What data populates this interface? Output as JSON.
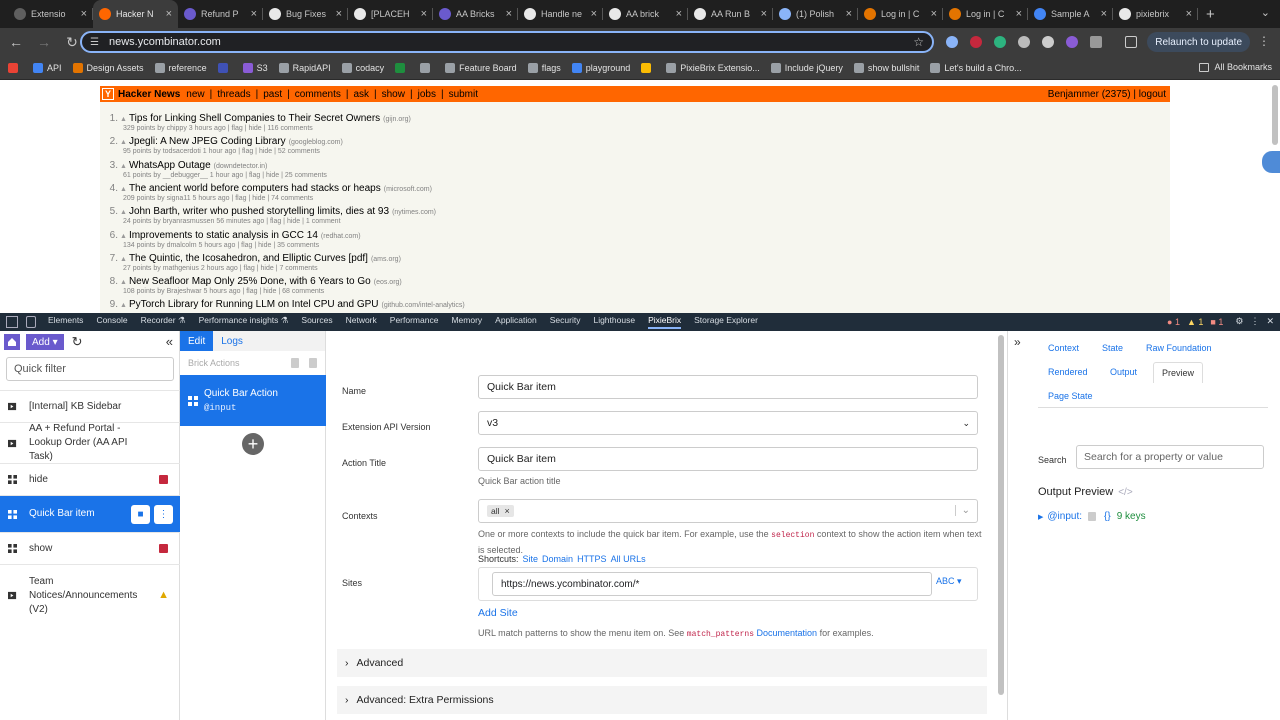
{
  "browser": {
    "tabs": [
      {
        "label": "Extensio",
        "color": "#5f5f5f"
      },
      {
        "label": "Hacker N",
        "color": "#ff6600",
        "active": true
      },
      {
        "label": "Refund P",
        "color": "#6a5acd"
      },
      {
        "label": "Bug Fixes",
        "color": "#e8e8e8"
      },
      {
        "label": "[PLACEH",
        "color": "#e8e8e8"
      },
      {
        "label": "AA Bricks",
        "color": "#6a5acd"
      },
      {
        "label": "Handle ne",
        "color": "#e8e8e8"
      },
      {
        "label": "AA brick",
        "color": "#e8e8e8"
      },
      {
        "label": "AA Run B",
        "color": "#e8e8e8"
      },
      {
        "label": "(1) Polish",
        "color": "#8ab4f8"
      },
      {
        "label": "Log in | C",
        "color": "#e37400"
      },
      {
        "label": "Log in | C",
        "color": "#e37400"
      },
      {
        "label": "Sample A",
        "color": "#4285f4"
      },
      {
        "label": "pixiebrix",
        "color": "#e8e8e8"
      }
    ],
    "new_tab": "+",
    "url": "news.ycombinator.com",
    "relaunch_label": "Relaunch to update",
    "bookmarks": [
      "API",
      "Design Assets",
      "reference",
      "",
      "S3",
      "RapidAPI",
      "codacy",
      "",
      "",
      "Feature Board",
      "flags",
      "playground",
      "",
      "PixieBrix Extensio...",
      "Include jQuery",
      "show bullshit",
      "Let's build a Chro..."
    ],
    "all_bookmarks": "All Bookmarks"
  },
  "hn": {
    "logo": "Y",
    "brand": "Hacker News",
    "nav": [
      "new",
      "|",
      "threads",
      "|",
      "past",
      "|",
      "comments",
      "|",
      "ask",
      "|",
      "show",
      "|",
      "jobs",
      "|",
      "submit"
    ],
    "user": "Benjammer (2375) | logout",
    "stories": [
      {
        "rank": "1.",
        "title": "Tips for Linking Shell Companies to Their Secret Owners",
        "site": "(gijn.org)",
        "sub": "329 points by chippy 3 hours ago | flag | hide | 116 comments"
      },
      {
        "rank": "2.",
        "title": "Jpegli: A New JPEG Coding Library",
        "site": "(googleblog.com)",
        "sub": "95 points by todsacerdoti 1 hour ago | flag | hide | 52 comments"
      },
      {
        "rank": "3.",
        "title": "WhatsApp Outage",
        "site": "(downdetector.in)",
        "sub": "61 points by __debugger__ 1 hour ago | flag | hide | 25 comments"
      },
      {
        "rank": "4.",
        "title": "The ancient world before computers had stacks or heaps",
        "site": "(microsoft.com)",
        "sub": "209 points by signa11 5 hours ago | flag | hide | 74 comments"
      },
      {
        "rank": "5.",
        "title": "John Barth, writer who pushed storytelling limits, dies at 93",
        "site": "(nytimes.com)",
        "sub": "24 points by bryanrasmussen 56 minutes ago | flag | hide | 1 comment"
      },
      {
        "rank": "6.",
        "title": "Improvements to static analysis in GCC 14",
        "site": "(redhat.com)",
        "sub": "134 points by dmalcolm 5 hours ago | flag | hide | 35 comments"
      },
      {
        "rank": "7.",
        "title": "The Quintic, the Icosahedron, and Elliptic Curves [pdf]",
        "site": "(ams.org)",
        "sub": "27 points by mathgenius 2 hours ago | flag | hide | 7 comments"
      },
      {
        "rank": "8.",
        "title": "New Seafloor Map Only 25% Done, with 6 Years to Go",
        "site": "(eos.org)",
        "sub": "108 points by Brajeshwar 5 hours ago | flag | hide | 68 comments"
      },
      {
        "rank": "9.",
        "title": "PyTorch Library for Running LLM on Intel CPU and GPU",
        "site": "(github.com/intel-analytics)",
        "sub": ""
      }
    ]
  },
  "devtools": {
    "tabs": [
      "Elements",
      "Console",
      "Recorder ⚗",
      "Performance insights ⚗",
      "Sources",
      "Network",
      "Performance",
      "Memory",
      "Application",
      "Security",
      "Lighthouse",
      "PixieBrix",
      "Storage Explorer"
    ],
    "active_tab": "PixieBrix",
    "errors": "1",
    "warnings": "1",
    "issues": "1"
  },
  "sidebar": {
    "add_label": "Add",
    "filter_placeholder": "Quick filter",
    "items": [
      {
        "label": "[Internal] KB Sidebar",
        "type": "folder"
      },
      {
        "label": "AA + Refund Portal - Lookup Order (AA API Task)",
        "type": "folder"
      },
      {
        "label": "hide",
        "type": "grid",
        "badge": "red"
      },
      {
        "label": "Quick Bar item",
        "type": "grid",
        "selected": true
      },
      {
        "label": "show",
        "type": "grid",
        "badge": "red"
      },
      {
        "label": "Team Notices/Announcements (V2)",
        "type": "folder",
        "badge": "warn"
      }
    ]
  },
  "bricks": {
    "edit_tab": "Edit",
    "logs_tab": "Logs",
    "header": "Brick Actions",
    "card_title": "Quick Bar Action",
    "card_sub": "@input"
  },
  "editor": {
    "name_label": "Name",
    "name_value": "Quick Bar item",
    "api_label": "Extension API Version",
    "api_value": "v3",
    "title_label": "Action Title",
    "title_value": "Quick Bar item",
    "title_help": "Quick Bar action title",
    "contexts_label": "Contexts",
    "context_chip": "all",
    "contexts_help_1": "One or more contexts to include the quick bar item. For example, use the",
    "contexts_help_code": "selection",
    "contexts_help_2": "context to show the action item when text is selected.",
    "sites_label": "Sites",
    "shortcuts_label": "Shortcuts:",
    "shortcuts": [
      "Site",
      "Domain",
      "HTTPS",
      "All URLs"
    ],
    "site_value": "https://news.ycombinator.com/*",
    "abc_label": "ABC",
    "add_site": "Add Site",
    "sites_help_1": "URL match patterns to show the menu item on. See",
    "sites_help_code": "match_patterns",
    "sites_help_link": "Documentation",
    "sites_help_2": "for examples.",
    "advanced": "Advanced",
    "advanced_perms": "Advanced: Extra Permissions"
  },
  "rpanel": {
    "tabs": [
      "Context",
      "State",
      "Raw Foundation",
      "Rendered",
      "Output",
      "Preview",
      "Page State"
    ],
    "active_tab": "Preview",
    "search_label": "Search",
    "search_placeholder": "Search for a property or value",
    "output_title": "Output Preview",
    "output_code": "</>",
    "tree_key": "@input:",
    "tree_brace": "{}",
    "tree_count": "9 keys"
  }
}
